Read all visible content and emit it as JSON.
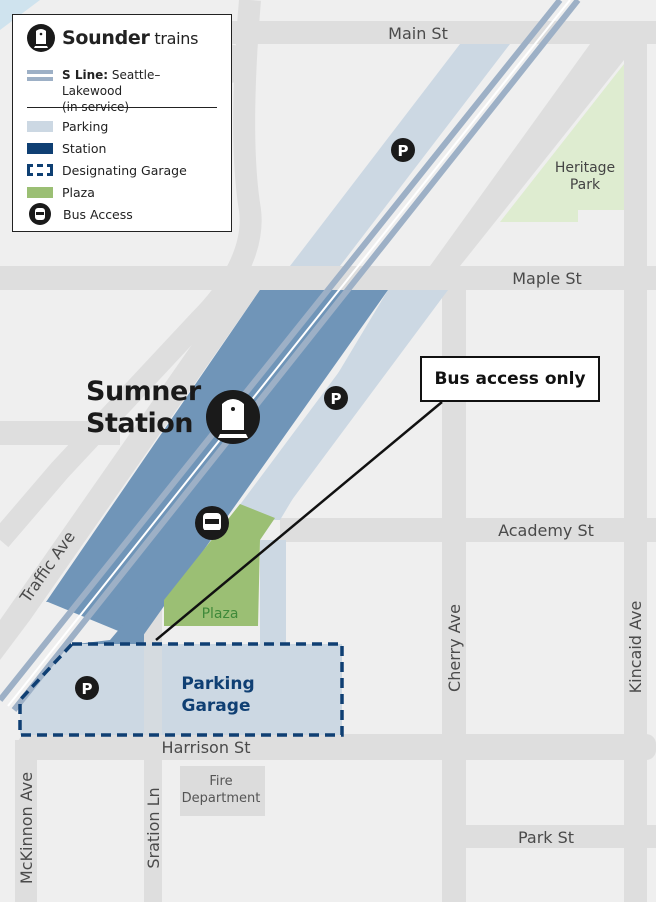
{
  "legend": {
    "title_bold": "Sounder",
    "title_rest": " trains",
    "line_label_bold": "S Line:",
    "line_label_rest": " Seattle–Lakewood",
    "line_status": "(in service)",
    "items": [
      {
        "label": "Parking",
        "color": "#ccd8e3"
      },
      {
        "label": "Station",
        "color": "#0f3f73"
      },
      {
        "label": "Designating Garage",
        "color": "#0f3f73"
      },
      {
        "label": "Plaza",
        "color": "#9bbf74"
      },
      {
        "label": "Bus Access",
        "color": "#1a1a1a"
      }
    ]
  },
  "colors": {
    "background": "#efefef",
    "street": "#dedede",
    "parking": "#ccd8e3",
    "station_platform": "#7095b8",
    "track": "#9db0c6",
    "plaza": "#9bbf74",
    "park": "#deecd0",
    "garage_outline": "#0f3f73",
    "water": "#cfe3ee"
  },
  "station": {
    "line1": "Sumner",
    "line2": "Station"
  },
  "callout": {
    "text": "Bus access only"
  },
  "streets": {
    "main": "Main St",
    "maple": "Maple St",
    "academy": "Academy St",
    "harrison": "Harrison St",
    "park": "Park St",
    "traffic": "Traffic Ave",
    "cherry": "Cherry Ave",
    "kincaid": "Kincaid Ave",
    "mckinnon": "McKinnon Ave",
    "sration": "Sration Ln"
  },
  "places": {
    "heritage_line1": "Heritage",
    "heritage_line2": "Park",
    "plaza": "Plaza",
    "garage_line1": "Parking",
    "garage_line2": "Garage",
    "fire_line1": "Fire",
    "fire_line2": "Department"
  },
  "icons": {
    "parking_letter": "P"
  }
}
